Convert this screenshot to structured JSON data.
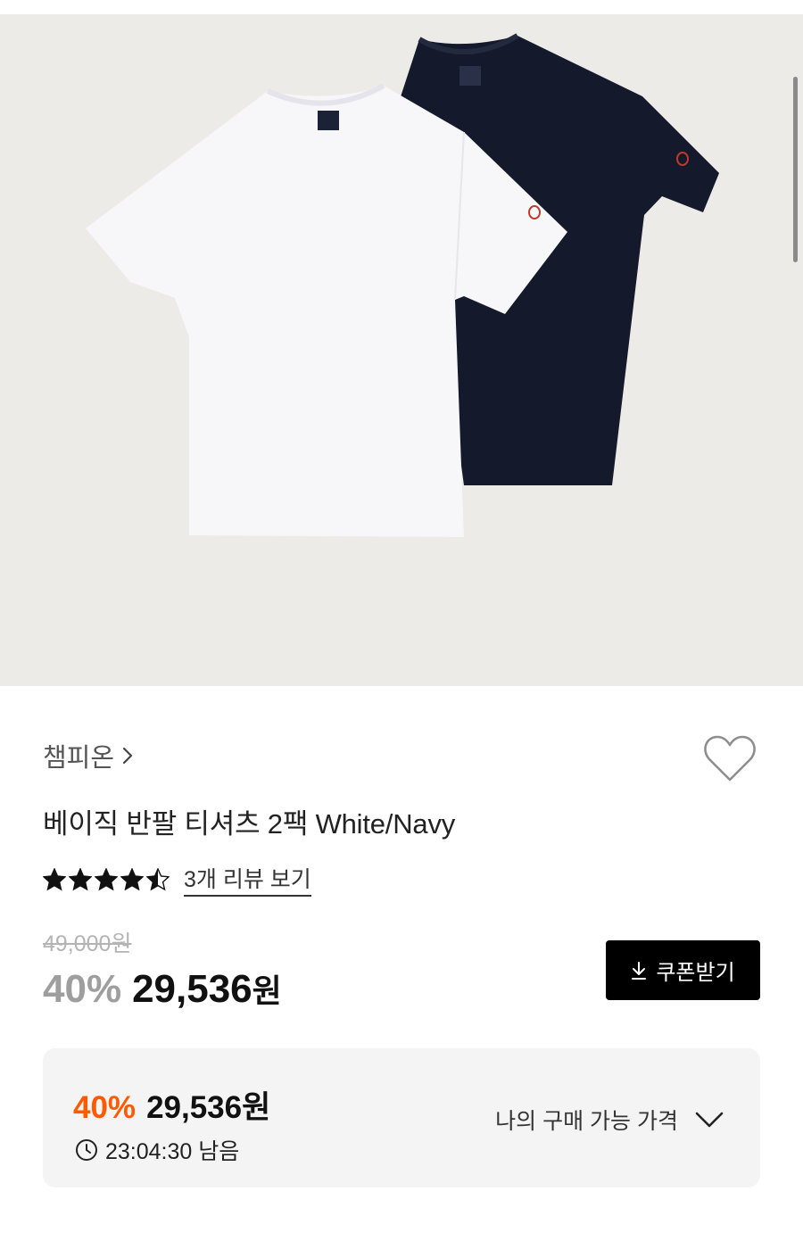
{
  "product": {
    "brand": "챔피온",
    "title": "베이직 반팔 티셔츠 2팩 White/Navy",
    "rating": 4.5,
    "rating_max": 5,
    "review_link": "3개 리뷰 보기",
    "original_price": "49,000원",
    "discount": "40%",
    "price_number": "29,536",
    "price_unit": "원",
    "coupon_button": "쿠폰받기"
  },
  "my_price": {
    "discount": "40%",
    "price": "29,536원",
    "timer": "23:04:30 남음",
    "toggle_label": "나의 구매 가능 가격"
  },
  "icons": {
    "brand_chevron": "chevron-right-icon",
    "wishlist": "heart-icon",
    "coupon": "download-icon",
    "timer": "clock-icon",
    "toggle": "chevron-down-icon"
  },
  "colors": {
    "discount_accent": "#ff5a00",
    "hero_background": "#edebe8",
    "white_shirt": "#f7f7f9",
    "navy_shirt": "#141a2b"
  }
}
